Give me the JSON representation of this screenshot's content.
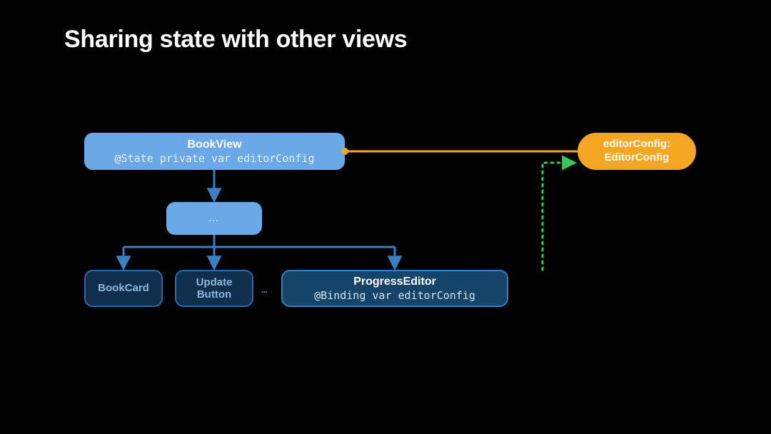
{
  "title": "Sharing state with other views",
  "nodes": {
    "bookview": {
      "name": "BookView",
      "subtitle": "@State private var editorConfig"
    },
    "editorconfig": {
      "name": "editorConfig:",
      "subtitle": "EditorConfig"
    },
    "ellipsis": {
      "name": "…"
    },
    "bookcard": {
      "name": "BookCard"
    },
    "updatebtn": {
      "line1": "Update",
      "line2": "Button"
    },
    "ellipsis2": "…",
    "progeditor": {
      "name": "ProgressEditor",
      "subtitle": "@Binding var editorConfig"
    }
  },
  "colors": {
    "lightBlue": "#6aa8e8",
    "darkBlueFill": "#0f2f4c",
    "darkBlueBorder": "#2f6aa8",
    "orange": "#f5a623",
    "green": "#35c759",
    "arrowBlue": "#3a7fbf"
  }
}
